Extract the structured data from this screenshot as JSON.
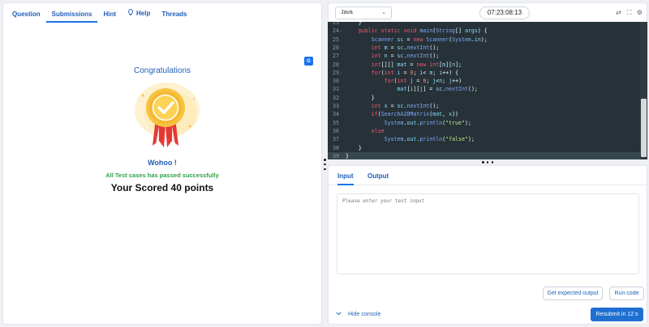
{
  "problem_panel": {
    "tabs": [
      {
        "label": "Question",
        "icon": null
      },
      {
        "label": "Submissions",
        "icon": null
      },
      {
        "label": "Hint",
        "icon": null
      },
      {
        "label": "Help",
        "icon": "lightbulb-icon"
      },
      {
        "label": "Threads",
        "icon": null
      }
    ],
    "active_tab": "Submissions",
    "result": {
      "title": "Congratulations",
      "exclaim": "Wohoo !",
      "status": "All Test cases has passed successfully",
      "score": "Your Scored 40 points"
    },
    "colors": {
      "accent": "#1f5fb8",
      "success": "#2ea14a",
      "badge_gold": "#f5b82e",
      "ribbon": "#e53935"
    }
  },
  "editor": {
    "language": "Java",
    "timer": "07:23:08:13",
    "icons": [
      "refresh-icon",
      "fullscreen-icon",
      "settings-icon"
    ],
    "lines": [
      {
        "n": "23",
        "fold": false,
        "code": [
          [
            "pl",
            "    }"
          ]
        ]
      },
      {
        "n": "24",
        "fold": true,
        "code": [
          [
            "kw",
            "    public static void "
          ],
          [
            "fn",
            "main"
          ],
          [
            "pl",
            "("
          ],
          [
            "ty",
            "String"
          ],
          [
            "pl",
            "[] "
          ],
          [
            "id",
            "args"
          ],
          [
            "pl",
            ") {"
          ]
        ]
      },
      {
        "n": "25",
        "fold": false,
        "code": [
          [
            "ty",
            "        Scanner "
          ],
          [
            "id",
            "sc"
          ],
          [
            "pl",
            " = "
          ],
          [
            "kw",
            "new "
          ],
          [
            "ty",
            "Scanner"
          ],
          [
            "pl",
            "("
          ],
          [
            "ty",
            "System"
          ],
          [
            "pl",
            "."
          ],
          [
            "id",
            "in"
          ],
          [
            "pl",
            ");"
          ]
        ]
      },
      {
        "n": "26",
        "fold": false,
        "code": [
          [
            "kw",
            "        int "
          ],
          [
            "id",
            "m"
          ],
          [
            "pl",
            " = "
          ],
          [
            "id",
            "sc"
          ],
          [
            "pl",
            "."
          ],
          [
            "fn",
            "nextInt"
          ],
          [
            "pl",
            "();"
          ]
        ]
      },
      {
        "n": "27",
        "fold": false,
        "code": [
          [
            "kw",
            "        int "
          ],
          [
            "id",
            "n"
          ],
          [
            "pl",
            " = "
          ],
          [
            "id",
            "sc"
          ],
          [
            "pl",
            "."
          ],
          [
            "fn",
            "nextInt"
          ],
          [
            "pl",
            "();"
          ]
        ]
      },
      {
        "n": "28",
        "fold": false,
        "code": [
          [
            "kw",
            "        int"
          ],
          [
            "pl",
            "[][] "
          ],
          [
            "id",
            "mat"
          ],
          [
            "pl",
            " = "
          ],
          [
            "kw",
            "new int"
          ],
          [
            "pl",
            "["
          ],
          [
            "id",
            "m"
          ],
          [
            "pl",
            "]["
          ],
          [
            "id",
            "n"
          ],
          [
            "pl",
            "];"
          ]
        ]
      },
      {
        "n": "29",
        "fold": true,
        "code": [
          [
            "kw",
            "        for"
          ],
          [
            "pl",
            "("
          ],
          [
            "kw",
            "int "
          ],
          [
            "id",
            "i"
          ],
          [
            "pl",
            " = "
          ],
          [
            "nm",
            "0"
          ],
          [
            "pl",
            "; "
          ],
          [
            "id",
            "i"
          ],
          [
            "pl",
            "< "
          ],
          [
            "id",
            "m"
          ],
          [
            "pl",
            "; "
          ],
          [
            "id",
            "i"
          ],
          [
            "pl",
            "++) {"
          ]
        ]
      },
      {
        "n": "30",
        "fold": false,
        "code": [
          [
            "kw",
            "            for"
          ],
          [
            "pl",
            "("
          ],
          [
            "kw",
            "int "
          ],
          [
            "id",
            "j"
          ],
          [
            "pl",
            " = "
          ],
          [
            "nm",
            "0"
          ],
          [
            "pl",
            "; "
          ],
          [
            "id",
            "j"
          ],
          [
            "pl",
            "<"
          ],
          [
            "id",
            "n"
          ],
          [
            "pl",
            "; "
          ],
          [
            "id",
            "j"
          ],
          [
            "pl",
            "++)"
          ]
        ]
      },
      {
        "n": "31",
        "fold": false,
        "code": [
          [
            "id",
            "                mat"
          ],
          [
            "pl",
            "["
          ],
          [
            "id",
            "i"
          ],
          [
            "pl",
            "]["
          ],
          [
            "id",
            "j"
          ],
          [
            "pl",
            "] = "
          ],
          [
            "id",
            "sc"
          ],
          [
            "pl",
            "."
          ],
          [
            "fn",
            "nextInt"
          ],
          [
            "pl",
            "();"
          ]
        ]
      },
      {
        "n": "32",
        "fold": false,
        "code": [
          [
            "pl",
            "        }"
          ]
        ]
      },
      {
        "n": "33",
        "fold": false,
        "code": [
          [
            "kw",
            "        int "
          ],
          [
            "id",
            "x"
          ],
          [
            "pl",
            " = "
          ],
          [
            "id",
            "sc"
          ],
          [
            "pl",
            "."
          ],
          [
            "fn",
            "nextInt"
          ],
          [
            "pl",
            "();"
          ]
        ]
      },
      {
        "n": "34",
        "fold": false,
        "code": [
          [
            "kw",
            "        if"
          ],
          [
            "pl",
            "("
          ],
          [
            "fn",
            "SearchA2DMatrix"
          ],
          [
            "pl",
            "("
          ],
          [
            "id",
            "mat"
          ],
          [
            "pl",
            ", "
          ],
          [
            "id",
            "x"
          ],
          [
            "pl",
            "))"
          ]
        ]
      },
      {
        "n": "35",
        "fold": false,
        "code": [
          [
            "ty",
            "            System"
          ],
          [
            "pl",
            "."
          ],
          [
            "id",
            "out"
          ],
          [
            "pl",
            "."
          ],
          [
            "fn",
            "println"
          ],
          [
            "pl",
            "("
          ],
          [
            "st",
            "\"true\""
          ],
          [
            "pl",
            ");"
          ]
        ]
      },
      {
        "n": "36",
        "fold": false,
        "code": [
          [
            "kw",
            "        else"
          ]
        ]
      },
      {
        "n": "37",
        "fold": false,
        "code": [
          [
            "ty",
            "            System"
          ],
          [
            "pl",
            "."
          ],
          [
            "id",
            "out"
          ],
          [
            "pl",
            "."
          ],
          [
            "fn",
            "println"
          ],
          [
            "pl",
            "("
          ],
          [
            "st",
            "\"false\""
          ],
          [
            "pl",
            ");"
          ]
        ]
      },
      {
        "n": "38",
        "fold": false,
        "code": [
          [
            "pl",
            "    }"
          ]
        ]
      },
      {
        "n": "39",
        "fold": false,
        "code": [
          [
            "pl",
            "}"
          ]
        ]
      }
    ],
    "active_line": "39",
    "colors": {
      "background": "#263238",
      "active_line": "#37474f"
    }
  },
  "console": {
    "tabs": [
      "Input",
      "Output"
    ],
    "active_tab": "Input",
    "input_placeholder": "Please enter your test input",
    "input_value": "",
    "buttons": {
      "expected": "Get expected output",
      "run": "Run code",
      "resubmit": "Resubmit in 12 s"
    },
    "hide_label": "Hide console",
    "colors": {
      "primary": "#1f6fd1"
    }
  }
}
